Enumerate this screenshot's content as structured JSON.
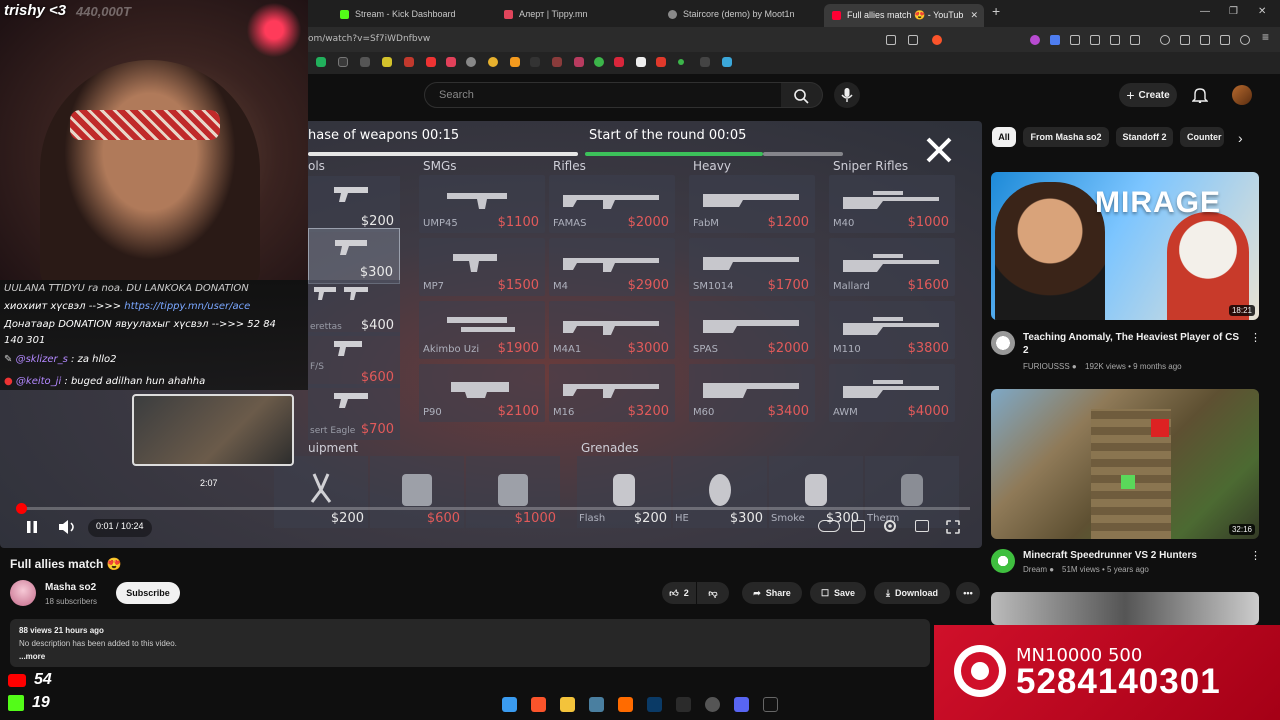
{
  "browser": {
    "tabs": [
      {
        "label": "Stream - Kick Dashboard",
        "color": "#53fc18"
      },
      {
        "label": "Алерт | Tippy.mn",
        "color": "#e0455b"
      },
      {
        "label": "Staircore (demo) by Moot1n",
        "color": "#8a8a8a"
      },
      {
        "label": "Full allies match 😍 - YouTub",
        "color": "#ff0033"
      }
    ],
    "url": "om/watch?v=Sf7iWDnfbvw"
  },
  "youtube": {
    "search_placeholder": "Search",
    "create_label": "Create"
  },
  "game": {
    "phase_label": "hase of weapons 00:15",
    "round_label": "Start of the round 00:05",
    "categories": [
      "ols",
      "SMGs",
      "Rifles",
      "Heavy",
      "Sniper Rifles"
    ],
    "pistols": [
      {
        "name": "",
        "price": "$200"
      },
      {
        "name": "",
        "price": "$300"
      },
      {
        "name": "erettas",
        "price": "$400"
      },
      {
        "name": "F/S",
        "price": "$600"
      },
      {
        "name": "sert Eagle",
        "price": "$700"
      }
    ],
    "smgs": [
      {
        "name": "UMP45",
        "price": "$1100"
      },
      {
        "name": "MP7",
        "price": "$1500"
      },
      {
        "name": "Akimbo Uzi",
        "price": "$1900"
      },
      {
        "name": "P90",
        "price": "$2100"
      }
    ],
    "rifles": [
      {
        "name": "FAMAS",
        "price": "$2000"
      },
      {
        "name": "M4",
        "price": "$2900"
      },
      {
        "name": "M4A1",
        "price": "$3000"
      },
      {
        "name": "M16",
        "price": "$3200"
      }
    ],
    "heavy": [
      {
        "name": "FabM",
        "price": "$1200"
      },
      {
        "name": "SM1014",
        "price": "$1700"
      },
      {
        "name": "SPAS",
        "price": "$2000"
      },
      {
        "name": "M60",
        "price": "$3400"
      }
    ],
    "snipers": [
      {
        "name": "M40",
        "price": "$1000"
      },
      {
        "name": "Mallard",
        "price": "$1600"
      },
      {
        "name": "M110",
        "price": "$3800"
      },
      {
        "name": "AWM",
        "price": "$4000"
      }
    ],
    "equipment_label": "uipment",
    "grenades_label": "Grenades",
    "equipment": [
      {
        "name": "",
        "price": "$200"
      },
      {
        "name": "",
        "price": "$600"
      },
      {
        "name": "",
        "price": "$1000"
      }
    ],
    "grenades": [
      {
        "name": "Flash",
        "price": "$200"
      },
      {
        "name": "HE",
        "price": "$300"
      },
      {
        "name": "Smoke",
        "price": "$300"
      },
      {
        "name": "Therm",
        "price": ""
      }
    ]
  },
  "player": {
    "preview_time": "2:07",
    "time": "0:01 / 10:24",
    "progress_fraction": 0.002
  },
  "video": {
    "title": "Full allies match 😍",
    "channel": "Masha so2",
    "subscribers": "18 subscribers",
    "subscribe_label": "Subscribe",
    "likes": "2",
    "share_label": "Share",
    "save_label": "Save",
    "download_label": "Download",
    "views_date": "88 views  21 hours ago",
    "description": "No description has been added to this video.",
    "more_label": "...more"
  },
  "sidebar": {
    "chips": [
      "All",
      "From Masha so2",
      "Standoff 2",
      "Counter"
    ],
    "videos": [
      {
        "title": "Teaching Anomaly, The Heaviest Player of CS 2",
        "channel": "FURIOUSSS",
        "meta": "192K views • 9 months ago",
        "duration": "18:21",
        "thumb_text": "MIRAGE"
      },
      {
        "title": "Minecraft Speedrunner VS 2 Hunters",
        "channel": "Dream",
        "meta": "51M views • 5 years ago",
        "duration": "32:16"
      }
    ]
  },
  "stream": {
    "streamer": "trishy <3",
    "viewers": "440,000T",
    "chat": [
      {
        "user": "",
        "text": "UULANA TTIDYU ra noa. DU LANKOKA DONATION"
      },
      {
        "user": "",
        "text": "хиохиит хүсвэл -->>> ",
        "link": "https://tippy.mn/user/ace"
      },
      {
        "user": "",
        "text": "Донатаар DONATION явуулахыг хүсвэл -->>> 52 84"
      },
      {
        "user": "",
        "text": "140 301"
      },
      {
        "user": "@sklizer_s",
        "text": " : za hllo2"
      },
      {
        "user": "@keito_ji",
        "text": " : buged adilhan hun ahahha"
      }
    ],
    "youtube_viewers": "54",
    "kick_viewers": "19",
    "donation_line1": "MN10000 500",
    "donation_line2": "5284140301"
  }
}
